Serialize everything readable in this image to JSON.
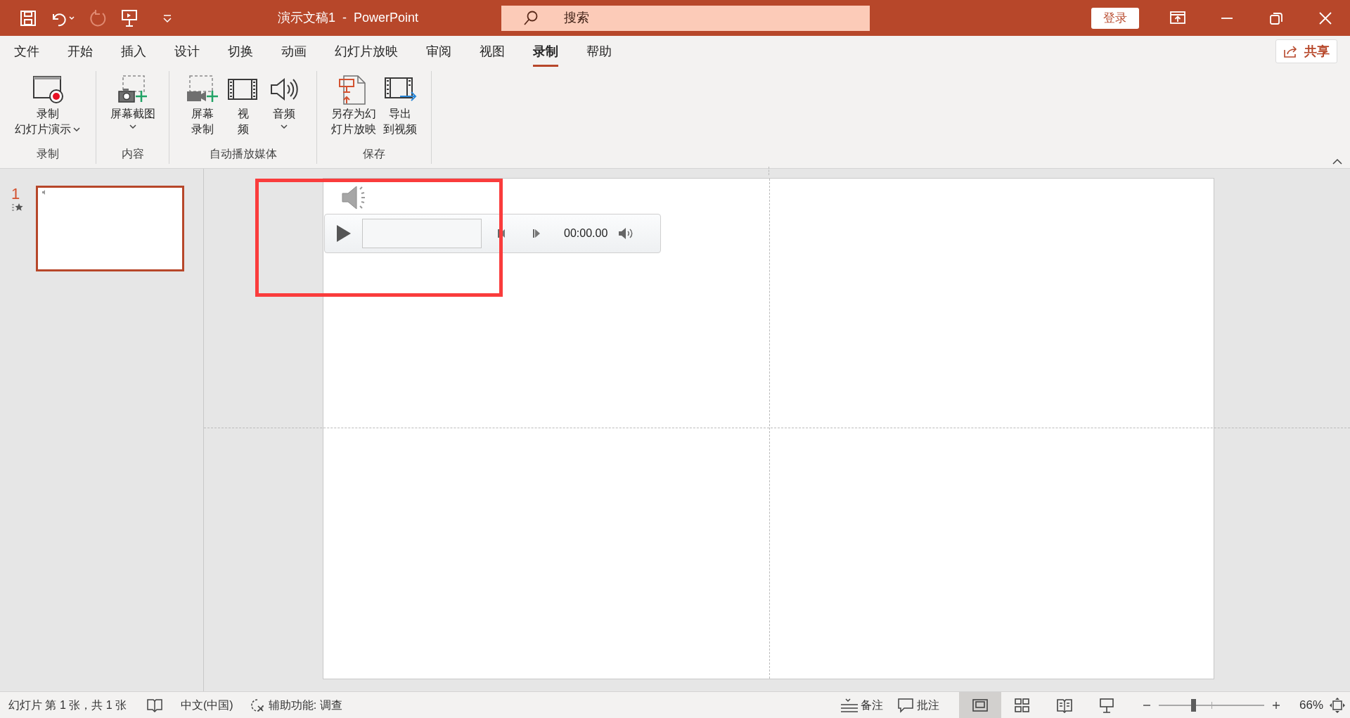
{
  "title": "演示文稿1  -  PowerPoint",
  "search": {
    "placeholder": "搜索"
  },
  "sign_in": "登录",
  "menu_tabs": [
    {
      "label": "文件",
      "selected": false
    },
    {
      "label": "开始",
      "selected": false
    },
    {
      "label": "插入",
      "selected": false
    },
    {
      "label": "设计",
      "selected": false
    },
    {
      "label": "切换",
      "selected": false
    },
    {
      "label": "动画",
      "selected": false
    },
    {
      "label": "幻灯片放映",
      "selected": false
    },
    {
      "label": "审阅",
      "selected": false
    },
    {
      "label": "视图",
      "selected": false
    },
    {
      "label": "录制",
      "selected": true
    },
    {
      "label": "帮助",
      "selected": false
    }
  ],
  "share": "共享",
  "ribbon_groups": [
    {
      "label": "录制",
      "buttons": [
        {
          "kind": "record",
          "lines": [
            "录制",
            "幻灯片演示"
          ],
          "dropdown": true
        }
      ]
    },
    {
      "label": "内容",
      "buttons": [
        {
          "kind": "screenshot",
          "lines": [
            "屏幕截图"
          ],
          "dropdown": true
        }
      ]
    },
    {
      "label": "自动播放媒体",
      "buttons": [
        {
          "kind": "screen-record",
          "lines": [
            "屏幕",
            "录制"
          ],
          "dropdown": false
        },
        {
          "kind": "video",
          "lines": [
            "视",
            "频"
          ],
          "dropdown": false
        },
        {
          "kind": "audio",
          "lines": [
            "音频"
          ],
          "dropdown": true
        }
      ]
    },
    {
      "label": "保存",
      "buttons": [
        {
          "kind": "save-show",
          "lines": [
            "另存为幻",
            "灯片放映"
          ],
          "dropdown": false
        },
        {
          "kind": "export-video",
          "lines": [
            "导出",
            "到视频"
          ],
          "dropdown": false
        }
      ]
    }
  ],
  "slides": [
    {
      "number": "1",
      "selected": true
    }
  ],
  "audio_player": {
    "time": "00:00.00"
  },
  "status_bar": {
    "slide_info": "幻灯片 第 1 张，共 1 张",
    "language": "中文(中国)",
    "accessibility": "辅助功能: 调查",
    "notes": "备注",
    "comments": "批注",
    "views": [
      {
        "kind": "normal",
        "selected": true
      },
      {
        "kind": "sorter",
        "selected": false
      },
      {
        "kind": "reading",
        "selected": false
      },
      {
        "kind": "slideshow",
        "selected": false
      }
    ],
    "zoom": {
      "level": 0.33,
      "reading": "66%"
    }
  }
}
